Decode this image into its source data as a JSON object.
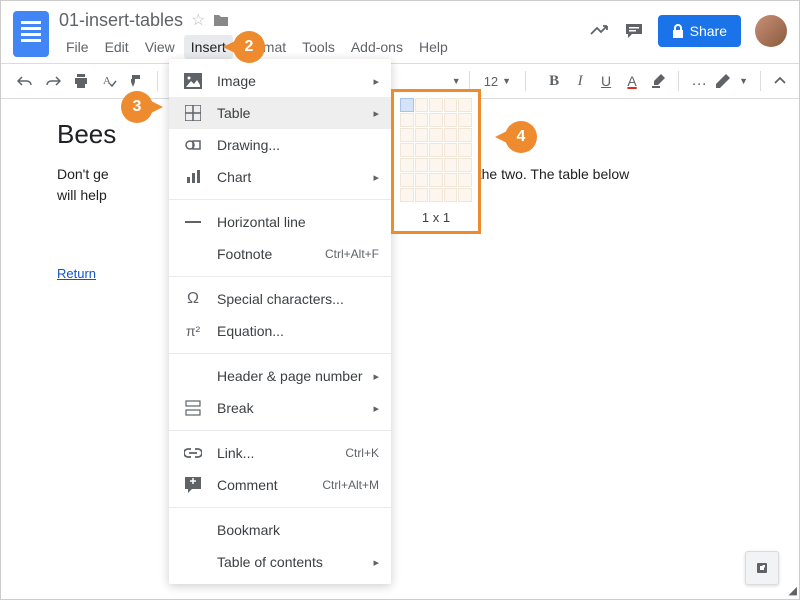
{
  "header": {
    "doc_title": "01-insert-tables",
    "share_label": "Share"
  },
  "menubar": [
    "File",
    "Edit",
    "View",
    "Insert",
    "Format",
    "Tools",
    "Add-ons",
    "Help"
  ],
  "menubar_active_index": 3,
  "toolbar": {
    "font_size": "12",
    "bold": "B",
    "italic": "I",
    "underline": "U",
    "text_color": "A",
    "more": "…"
  },
  "document": {
    "heading_fragment": "Bees",
    "paragraph_left": "Don't ge",
    "paragraph_right": "tween the two. The table below",
    "paragraph_line2": "will help",
    "link_text": "Return "
  },
  "insert_menu": [
    {
      "icon": "image-icon",
      "label": "Image",
      "arrow": true
    },
    {
      "icon": "table-icon",
      "label": "Table",
      "arrow": true,
      "highlight": true
    },
    {
      "icon": "drawing-icon",
      "label": "Drawing...",
      "arrow": false
    },
    {
      "icon": "chart-icon",
      "label": "Chart",
      "arrow": true
    },
    {
      "divider": true
    },
    {
      "icon": "line-icon",
      "label": "Horizontal line"
    },
    {
      "icon": "footnote-icon",
      "label": "Footnote",
      "shortcut": "Ctrl+Alt+F"
    },
    {
      "divider": true
    },
    {
      "icon": "omega-icon",
      "label": "Special characters..."
    },
    {
      "icon": "pi-icon",
      "label": "Equation..."
    },
    {
      "divider": true
    },
    {
      "icon": "",
      "label": "Header & page number",
      "arrow": true
    },
    {
      "icon": "break-icon",
      "label": "Break",
      "arrow": true
    },
    {
      "divider": true
    },
    {
      "icon": "link-icon",
      "label": "Link...",
      "shortcut": "Ctrl+K"
    },
    {
      "icon": "comment-icon",
      "label": "Comment",
      "shortcut": "Ctrl+Alt+M"
    },
    {
      "divider": true
    },
    {
      "icon": "",
      "label": "Bookmark"
    },
    {
      "icon": "",
      "label": "Table of contents",
      "arrow": true
    }
  ],
  "table_submenu": {
    "cols": 5,
    "rows": 7,
    "selected_cols": 1,
    "selected_rows": 1,
    "label": "1 x 1"
  },
  "callouts": {
    "c2": "2",
    "c3": "3",
    "c4": "4"
  }
}
